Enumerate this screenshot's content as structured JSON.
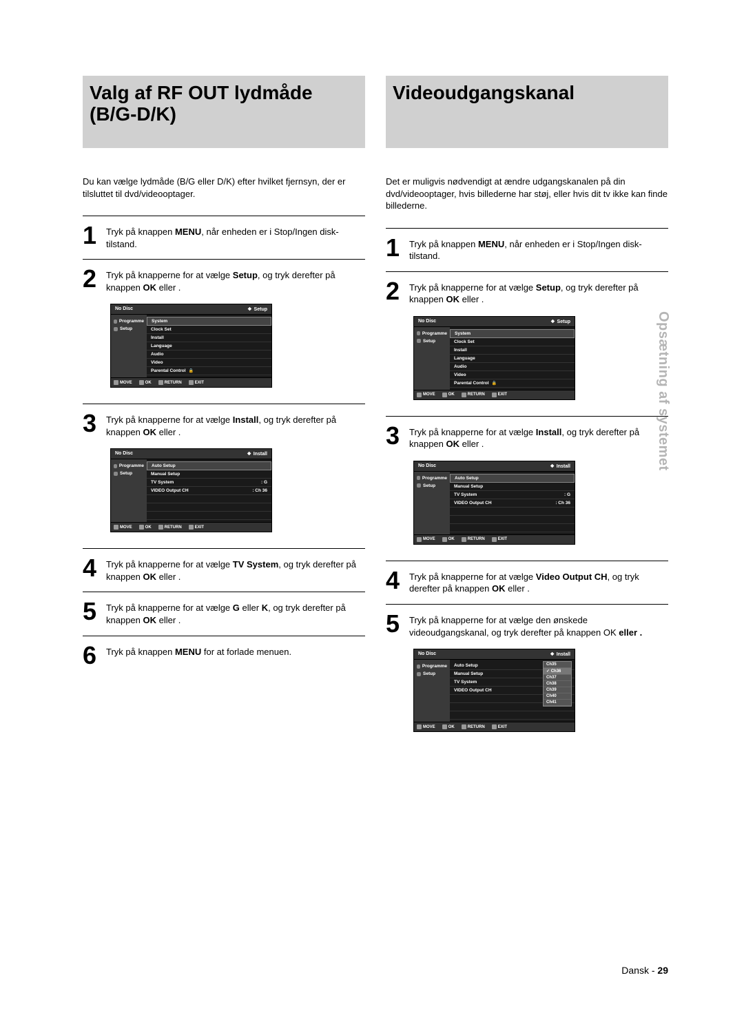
{
  "side_tab": "Opsætning af systemet",
  "footer": {
    "lang": "Dansk",
    "sep": " - ",
    "page": "29"
  },
  "left": {
    "title": "Valg af RF OUT lydmåde (B/G-D/K)",
    "intro": "Du kan vælge lydmåde (B/G eller D/K) efter hvilket fjernsyn, der er tilsluttet til dvd/videooptager.",
    "steps": {
      "s1": {
        "n": "1",
        "t": [
          "Tryk på knappen ",
          "MENU",
          ", når enheden er i Stop/Ingen disk-tilstand."
        ]
      },
      "s2": {
        "n": "2",
        "t": [
          "Tryk på knapperne        for at vælge ",
          "Setup",
          ", og tryk derefter på knappen ",
          "OK",
          " eller      ."
        ]
      },
      "s3": {
        "n": "3",
        "t": [
          "Tryk på knapperne        for at vælge ",
          "Install",
          ", og tryk derefter på knappen ",
          "OK",
          " eller      ."
        ]
      },
      "s4": {
        "n": "4",
        "t": [
          "Tryk på knapperne        for at vælge ",
          "TV System",
          ", og tryk derefter på knappen ",
          "OK",
          " eller      ."
        ]
      },
      "s5": {
        "n": "5",
        "t": [
          "Tryk på knapperne        for at vælge ",
          "G",
          " eller ",
          "K",
          ", og tryk derefter på knappen ",
          "OK",
          " eller      ."
        ]
      },
      "s6": {
        "n": "6",
        "t": [
          "Tryk på knappen ",
          "MENU",
          " for at forlade menuen."
        ]
      }
    }
  },
  "right": {
    "title": "Videoudgangskanal",
    "intro": "Det er muligvis nødvendigt at ændre udgangskanalen på din dvd/videooptager, hvis billederne har støj, eller hvis dit tv ikke kan finde billederne.",
    "steps": {
      "s1": {
        "n": "1",
        "t": [
          "Tryk på knappen ",
          "MENU",
          ", når enheden er i Stop/Ingen disk-tilstand."
        ]
      },
      "s2": {
        "n": "2",
        "t": [
          "Tryk på knapperne        for at vælge ",
          "Setup",
          ", og tryk derefter på knappen ",
          "OK",
          " eller      ."
        ]
      },
      "s3": {
        "n": "3",
        "t": [
          "Tryk på knapperne        for at vælge ",
          "Install",
          ", og tryk derefter på knappen ",
          "OK",
          " eller      ."
        ]
      },
      "s4": {
        "n": "4",
        "t": [
          "Tryk på knapperne        for at vælge ",
          "Video Output CH",
          ", og tryk derefter på knappen ",
          "OK",
          " eller      ."
        ]
      },
      "s5": {
        "n": "5",
        "t": [
          "Tryk på knapperne        for at vælge den ønskede videoudgangskanal, og tryk derefter på knappen ",
          "OK",
          " eller      ."
        ]
      }
    }
  },
  "osd": {
    "nodisc": "No Disc",
    "setup_crumb": "Setup",
    "install_crumb": "Install",
    "left_items": {
      "prog": "Programme",
      "setup": "Setup"
    },
    "setup_menu": [
      "System",
      "Clock Set",
      "Install",
      "Language",
      "Audio",
      "Video",
      "Parental Control"
    ],
    "install_menu": {
      "auto": "Auto Setup",
      "manual": "Manual Setup",
      "tvsys": "TV System",
      "tvsys_val": ": G",
      "vout": "VIDEO Output CH",
      "vout_val": ": Ch 36"
    },
    "popup": [
      "Ch35",
      "Ch36",
      "Ch37",
      "Ch38",
      "Ch39",
      "Ch40",
      "Ch41"
    ],
    "foot": {
      "move": "MOVE",
      "ok": "OK",
      "return": "RETURN",
      "exit": "EXIT"
    }
  }
}
